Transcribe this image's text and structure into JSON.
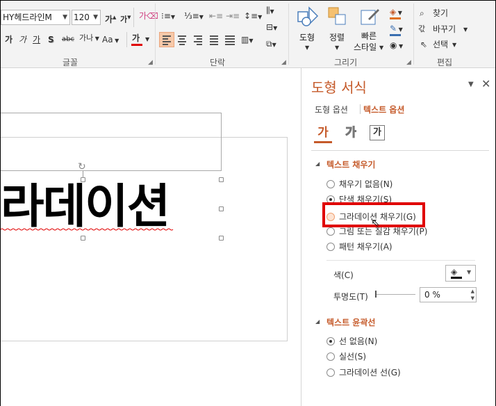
{
  "ribbon": {
    "font_name": "HY헤드라인M",
    "font_size": "120",
    "font_row2_icons": [
      "가",
      "가",
      "가",
      "S",
      "abc",
      "가나",
      "Aa",
      "가"
    ],
    "groups": {
      "font": "글꼴",
      "paragraph": "단락",
      "drawing": "그리기",
      "editing": "편집"
    },
    "buttons": {
      "shape": "도형",
      "arrange": "정렬",
      "quick_styles_line1": "빠른",
      "quick_styles_line2": "스타일",
      "find": "찾기",
      "replace": "바꾸기",
      "select": "선택"
    }
  },
  "slide": {
    "text": "라데이션"
  },
  "pane": {
    "title": "도형 서식",
    "tabs": [
      "도형 옵션",
      "텍스트 옵션"
    ],
    "selected_tab": "텍스트 옵션",
    "sub_icons": [
      "가",
      "가",
      "가"
    ],
    "text_fill": {
      "heading": "텍스트 채우기",
      "options": [
        "채우기 없음(N)",
        "단색 채우기(S)",
        "그라데이션 채우기(G)",
        "그림 또는 질감 채우기(P)",
        "패턴 채우기(A)"
      ],
      "selected_index": 1,
      "color_label": "색(C)",
      "transparency_label": "투명도(T)",
      "transparency_value": "0 %"
    },
    "text_outline": {
      "heading": "텍스트 윤곽선",
      "options": [
        "선 없음(N)",
        "실선(S)",
        "그라데이션 선(G)"
      ],
      "selected_index": 0
    }
  },
  "colors": {
    "accent": "#c55a2a",
    "highlight": "#e00000",
    "active_align": "#f7c9a9"
  }
}
